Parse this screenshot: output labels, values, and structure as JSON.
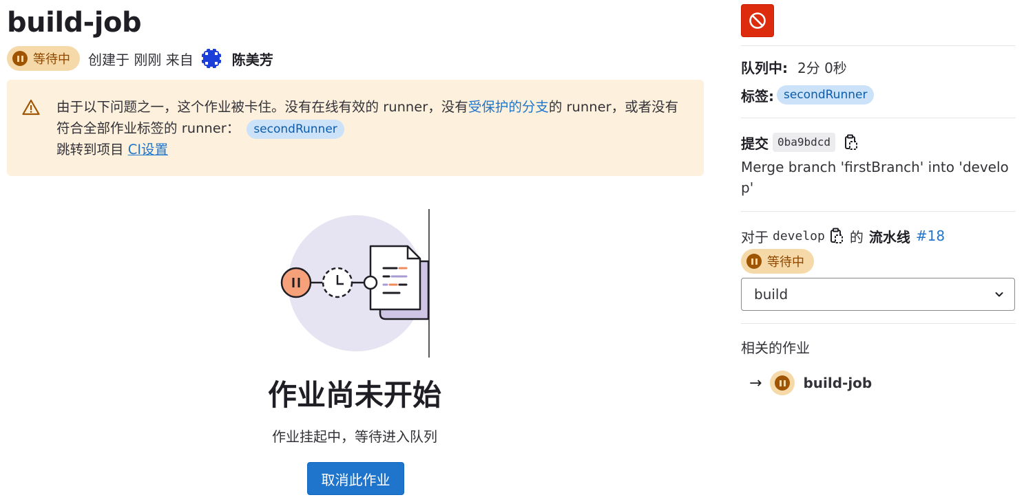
{
  "job": {
    "title": "build-job",
    "status_label": "等待中",
    "created_text": "创建于 刚刚 来自",
    "author": "陈美芳"
  },
  "alert": {
    "text_part1": "由于以下问题之一，这个作业被卡住。没有在线有效的 runner，没有",
    "link_text": "受保护的分支",
    "text_part2": "的 runner，或者没有符合全部作业标签的 runner：",
    "tag": "secondRunner",
    "goto_text": "跳转到项目 ",
    "ci_link": "CI设置"
  },
  "empty_state": {
    "title": "作业尚未开始",
    "description": "作业挂起中，等待进入队列",
    "cancel_button": "取消此作业"
  },
  "sidebar": {
    "queued_label": "队列中:",
    "queued_value": "2分 0秒",
    "tags_label": "标签:",
    "tag": "secondRunner",
    "commit_label": "提交",
    "commit_sha": "0ba9bdcd",
    "commit_message": "Merge branch 'firstBranch' into 'develop'",
    "pipeline_prefix": "对于",
    "branch": "develop",
    "pipeline_of": "的",
    "pipeline_label": "流水线",
    "pipeline_link": "#18",
    "pipeline_status": "等待中",
    "stage_selected": "build",
    "related_title": "相关的作业",
    "related_arrow": "→",
    "related_job": "build-job"
  },
  "colors": {
    "accent": "#1f75cb",
    "danger": "#dd2b0e",
    "pending_bg": "#f5d9a8",
    "pending_fg": "#9e5400",
    "alert_bg": "#fdf1dd"
  },
  "icons": [
    "pause-icon",
    "warning-icon",
    "cancel-icon",
    "copy-icon",
    "chevron-down-icon",
    "arrow-right-icon"
  ]
}
